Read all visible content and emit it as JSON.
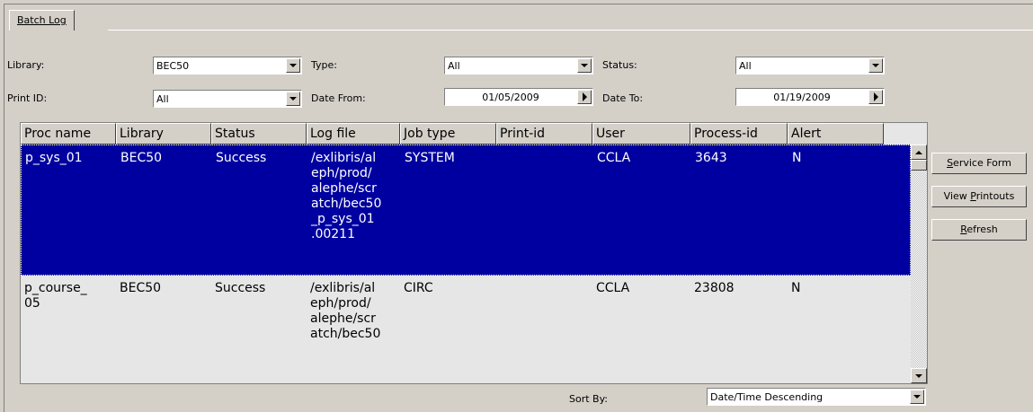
{
  "tab": {
    "label": "Batch Log"
  },
  "filters": {
    "library_label": "Library:",
    "library_value": "BEC50",
    "type_label": "Type:",
    "type_value": "All",
    "status_label": "Status:",
    "status_value": "All",
    "printid_label": "Print ID:",
    "printid_value": "All",
    "date_from_label": "Date From:",
    "date_from_value": "01/05/2009",
    "date_to_label": "Date To:",
    "date_to_value": "01/19/2009"
  },
  "table": {
    "columns": [
      "Proc name",
      "Library",
      "Status",
      "Log file",
      "Job type",
      "Print-id",
      "User",
      "Process-id",
      "Alert"
    ],
    "rows": [
      [
        "p_sys_01",
        "BEC50",
        "Success",
        "/exlibris/al\neph/prod/\nalephe/scr\natch/bec50\n_p_sys_01\n.00211",
        "SYSTEM",
        "",
        "CCLA",
        "3643",
        "N"
      ],
      [
        "p_course_\n05",
        "BEC50",
        "Success",
        "/exlibris/al\neph/prod/\nalephe/scr\natch/bec50",
        "CIRC",
        "",
        "CCLA",
        "23808",
        "N"
      ]
    ]
  },
  "buttons": {
    "service_form": {
      "mn": "S",
      "rest": "ervice Form"
    },
    "view_printouts": {
      "pre": "View ",
      "mn": "P",
      "rest": "rintouts"
    },
    "refresh": {
      "mn": "R",
      "rest": "efresh"
    }
  },
  "sort": {
    "label": "Sort By:",
    "value": "Date/Time Descending"
  },
  "colors": {
    "selection": "#0000a0",
    "window": "#d4d0c8"
  }
}
